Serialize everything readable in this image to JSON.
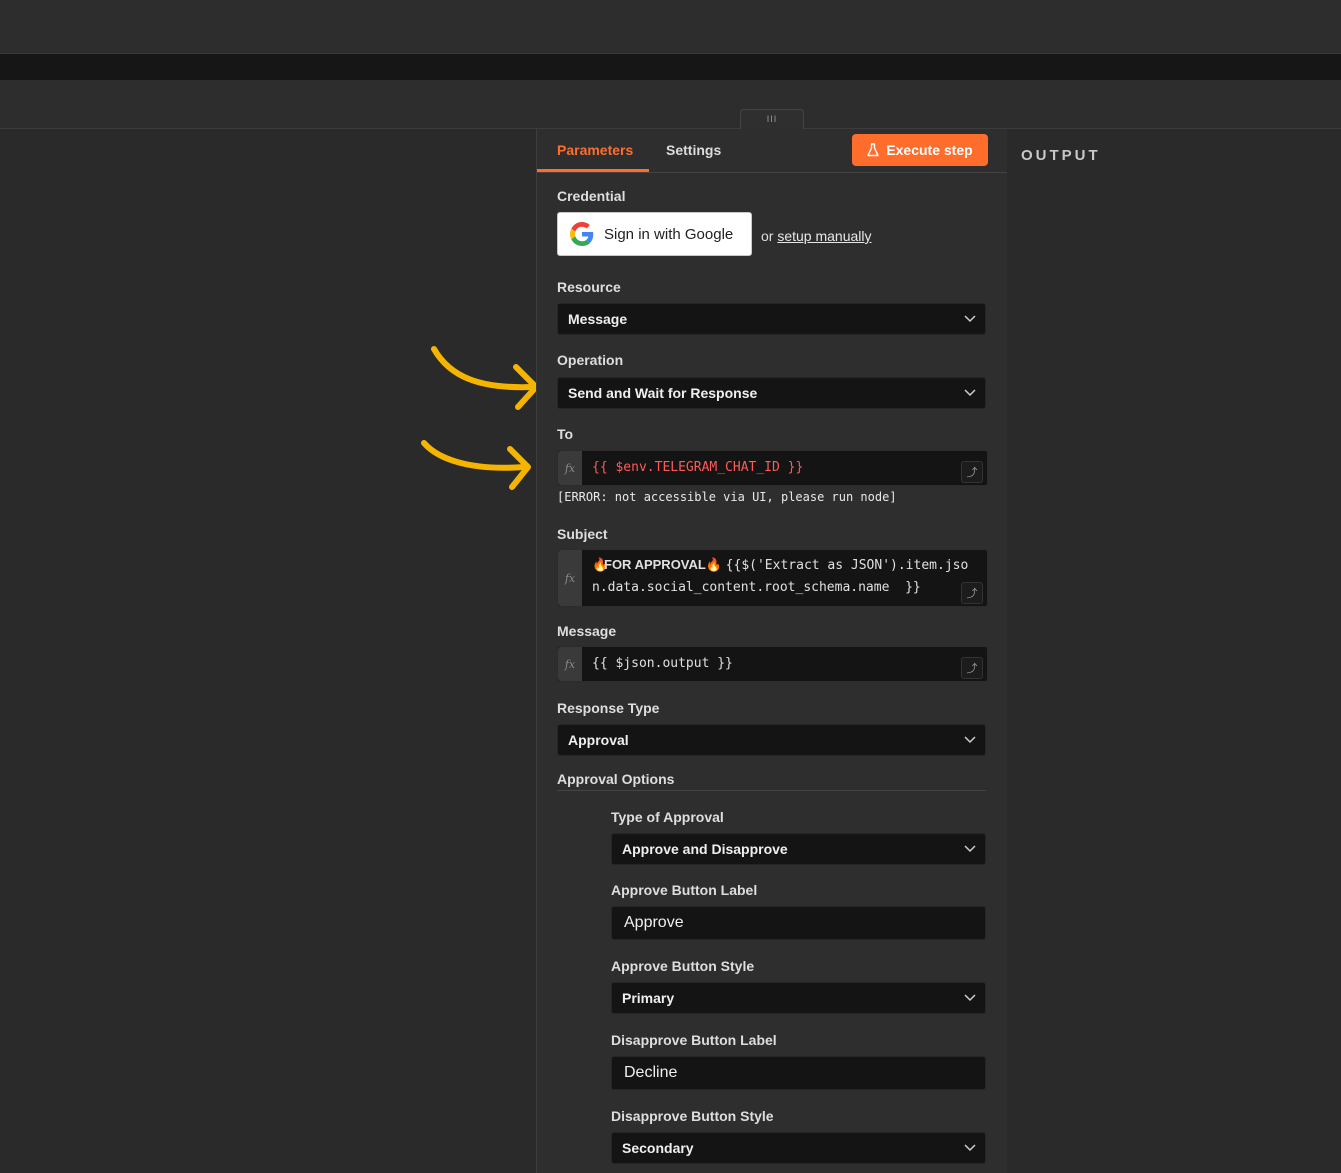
{
  "tabs": {
    "parameters": "Parameters",
    "settings": "Settings"
  },
  "execute_button": "Execute step",
  "output_title": "OUTPUT",
  "handle_glyph": "III",
  "credential": {
    "label": "Credential",
    "google_button": "Sign in with Google",
    "or_text": "or",
    "setup_link": "setup manually"
  },
  "resource": {
    "label": "Resource",
    "value": "Message"
  },
  "operation": {
    "label": "Operation",
    "value": "Send and Wait for Response"
  },
  "to": {
    "label": "To",
    "expression": "{{ $env.TELEGRAM_CHAT_ID }}",
    "error": "[ERROR: not accessible via UI, please run node]"
  },
  "subject": {
    "label": "Subject",
    "emoji": "🔥",
    "bold_text": "FOR APPROVAL",
    "expression_line1": "{{$('Extract as JSON').item.jso",
    "expression_line2": "n.data.social_content.root_schema.name  }}"
  },
  "message": {
    "label": "Message",
    "expression": "{{ $json.output }}"
  },
  "response_type": {
    "label": "Response Type",
    "value": "Approval"
  },
  "approval_options": {
    "label": "Approval Options",
    "type_of_approval": {
      "label": "Type of Approval",
      "value": "Approve and Disapprove"
    },
    "approve_label": {
      "label": "Approve Button Label",
      "value": "Approve"
    },
    "approve_style": {
      "label": "Approve Button Style",
      "value": "Primary"
    },
    "disapprove_label": {
      "label": "Disapprove Button Label",
      "value": "Decline"
    },
    "disapprove_style": {
      "label": "Disapprove Button Style",
      "value": "Secondary"
    }
  },
  "colors": {
    "accent": "#ff6d2d",
    "arrow": "#f5b400",
    "error_text": "#ff5a5a"
  }
}
